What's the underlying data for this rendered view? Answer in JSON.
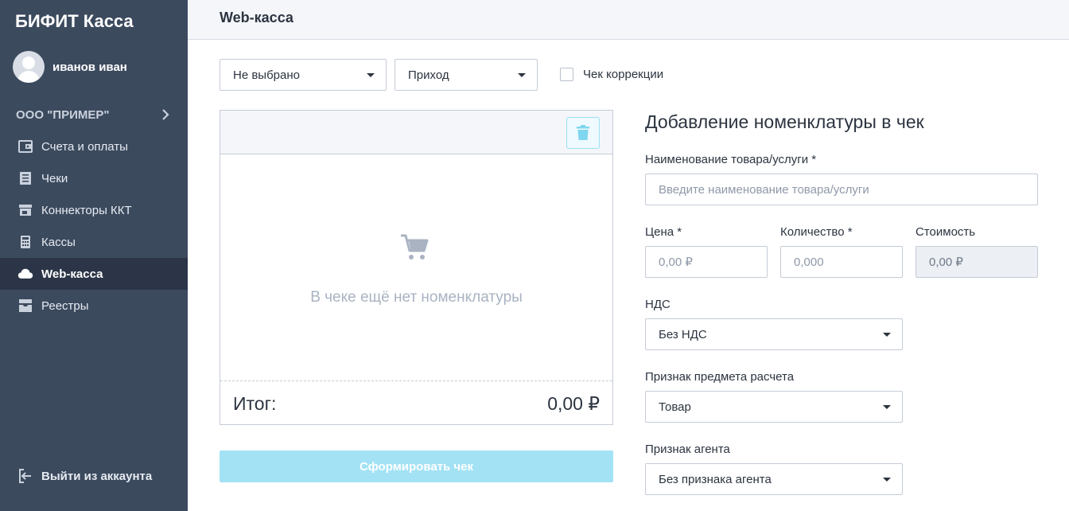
{
  "sidebar": {
    "brand": "БИФИТ Касса",
    "user_name": "иванов иван",
    "org": "ООО \"ПРИМЕР\"",
    "nav": [
      {
        "label": "Счета и оплаты",
        "icon": "wallet-icon"
      },
      {
        "label": "Чеки",
        "icon": "receipt-icon"
      },
      {
        "label": "Коннекторы ККТ",
        "icon": "store-icon"
      },
      {
        "label": "Кассы",
        "icon": "calculator-icon"
      },
      {
        "label": "Web-касса",
        "icon": "cloud-icon",
        "active": true
      },
      {
        "label": "Реестры",
        "icon": "archive-icon"
      }
    ],
    "logout": "Выйти из аккаунта"
  },
  "header": {
    "title": "Web-касса"
  },
  "filters": {
    "select1": "Не выбрано",
    "select2": "Приход",
    "correction_label": "Чек коррекции",
    "correction_checked": false
  },
  "receipt": {
    "empty_text": "В чеке ещё нет номенклатуры",
    "total_label": "Итог:",
    "total_value": "0,00 ₽",
    "submit_label": "Сформировать чек"
  },
  "form": {
    "title": "Добавление номенклатуры в чек",
    "name_label": "Наименование товара/услуги *",
    "name_placeholder": "Введите наименование товара/услуги",
    "price_label": "Цена *",
    "price_placeholder": "0,00 ₽",
    "qty_label": "Количество *",
    "qty_placeholder": "0,000",
    "cost_label": "Стоимость",
    "cost_value": "0,00 ₽",
    "vat_label": "НДС",
    "vat_value": "Без НДС",
    "subject_label": "Признак предмета расчета",
    "subject_value": "Товар",
    "agent_label": "Признак агента",
    "agent_value": "Без признака агента"
  },
  "colors": {
    "sidebar_bg": "#3c4a5e",
    "sidebar_active": "#2b3547",
    "accent": "#a3e2f5"
  }
}
